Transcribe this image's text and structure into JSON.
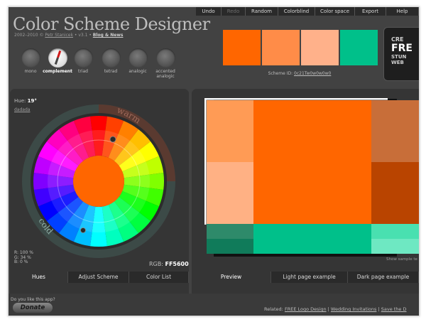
{
  "header": {
    "title": "Color Scheme Designer",
    "meta_prefix": "2002–2010 © ",
    "author": "Petr Stanicek",
    "version": " • v3.1 • ",
    "blog_link": "Blog & News"
  },
  "menu": [
    "Undo",
    "Redo",
    "Random",
    "Colorblind",
    "Color space",
    "Export",
    "Help"
  ],
  "modes": [
    {
      "label": "mono",
      "active": false
    },
    {
      "label": "complement",
      "active": true
    },
    {
      "label": "triad",
      "active": false
    },
    {
      "label": "tetrad",
      "active": false
    },
    {
      "label": "analogic",
      "active": false
    },
    {
      "label": "accented analogic",
      "active": false
    }
  ],
  "scheme": {
    "swatches": [
      "#FF6600",
      "#FF8C48",
      "#FFB18A",
      "#00C08A"
    ],
    "id_label": "Scheme ID: ",
    "id_value": "0c21Tw0w0w0w0"
  },
  "ad": {
    "l1": "CRE",
    "l2": "FRE",
    "l3": "STUN",
    "l4": "WEB"
  },
  "hue": {
    "label": "Hue: ",
    "value": "19°",
    "link": "dadada",
    "warm": "warm",
    "cold": "cold",
    "rgb_r": "R: 100 %",
    "rgb_g": "G:  34 %",
    "rgb_b": "B:   0 %",
    "rgb_label": "RGB: ",
    "rgb_hex": "FF5600"
  },
  "colors": {
    "primary": "#FF6600",
    "primary_light": "#FF9B55",
    "primary_lighter": "#FFB184",
    "primary_dark": "#B94400",
    "primary_muted": "#C86E39",
    "complement": "#00C08A",
    "complement_dark": "#107B5A",
    "complement_muted": "#2E8A6A",
    "complement_light": "#49E0B0",
    "complement_lighter": "#6EE8C2"
  },
  "left_tabs": [
    "Hues",
    "Adjust Scheme",
    "Color List"
  ],
  "right_tabs": [
    "Preview",
    "Light page example",
    "Dark page example"
  ],
  "preview_note": "Show sample te",
  "footer": {
    "question": "Do you like this app?",
    "donate": "Donate",
    "related_label": "Related: ",
    "links": [
      "FREE Logo Design",
      "Wedding Invitations",
      "Save the D"
    ]
  }
}
